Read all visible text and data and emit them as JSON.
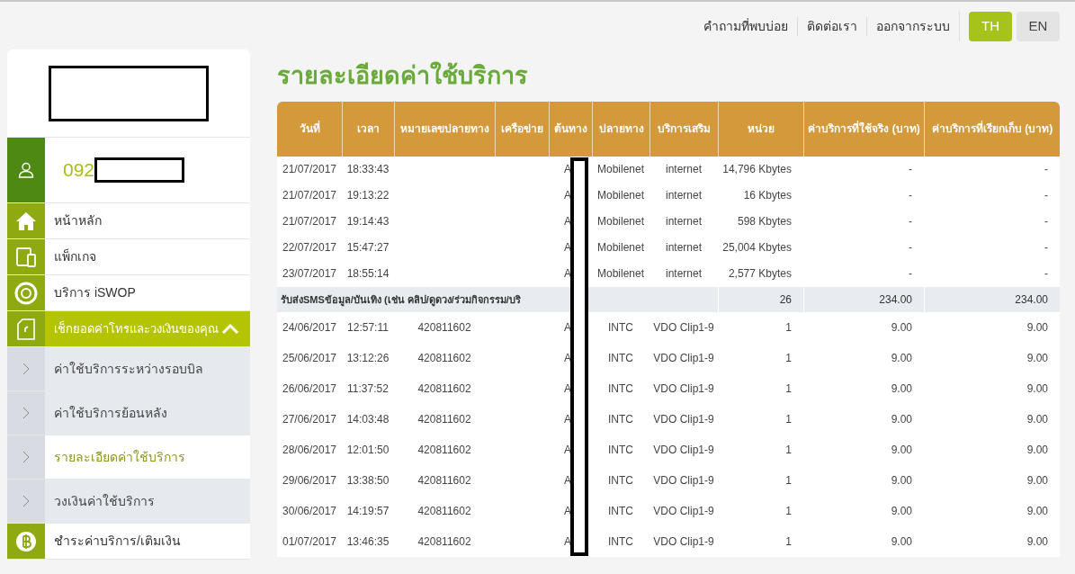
{
  "top_nav": {
    "links": [
      {
        "label": "คำถามที่พบบ่อย"
      },
      {
        "label": "ติดต่อเรา"
      },
      {
        "label": "ออกจากระบบ"
      }
    ],
    "languages": [
      {
        "label": "TH",
        "selected": true
      },
      {
        "label": "EN",
        "selected": false
      }
    ]
  },
  "sidebar": {
    "account_number": "092",
    "items": [
      {
        "label": "หน้าหลัก",
        "selected": false
      },
      {
        "label": "แพ็กเกจ",
        "selected": false
      },
      {
        "label": "บริการ iSWOP",
        "selected": false
      },
      {
        "label": "เช็กยอดค่าโทรและวงเงินของคุณ",
        "selected": true,
        "expanded": true,
        "children": [
          {
            "label": "ค่าใช้บริการระหว่างรอบบิล",
            "selected": false
          },
          {
            "label": "ค่าใช้บริการย้อนหลัง",
            "selected": false
          },
          {
            "label": "รายละเอียดค่าใช้บริการ",
            "selected": true
          },
          {
            "label": "วงเงินค่าใช้บริการ",
            "selected": false
          }
        ]
      },
      {
        "label": "ชำระค่าบริการ/เติมเงิน",
        "selected": false
      }
    ]
  },
  "page_title": "รายละเอียดค่าใช้บริการ",
  "table": {
    "columns": [
      "วันที่",
      "เวลา",
      "หมายเลขปลายทาง",
      "เครือข่าย",
      "ต้นทาง",
      "ปลายทาง",
      "บริการเสริม",
      "หน่วย",
      "ค่าบริการที่ใช้จริง (บาท)",
      "ค่าบริการที่เรียกเก็บ (บาท)"
    ],
    "rows": [
      {
        "kind": "row",
        "cells": [
          "21/07/2017",
          "18:33:43",
          "",
          "",
          "A",
          "Mobilenet",
          "internet",
          "14,796 Kbytes",
          "-",
          "-"
        ]
      },
      {
        "kind": "row",
        "cells": [
          "21/07/2017",
          "19:13:22",
          "",
          "",
          "A",
          "Mobilenet",
          "internet",
          "16 Kbytes",
          "-",
          "-"
        ]
      },
      {
        "kind": "row",
        "cells": [
          "21/07/2017",
          "19:14:43",
          "",
          "",
          "A",
          "Mobilenet",
          "internet",
          "598 Kbytes",
          "-",
          "-"
        ]
      },
      {
        "kind": "row",
        "cells": [
          "22/07/2017",
          "15:47:27",
          "",
          "",
          "A",
          "Mobilenet",
          "internet",
          "25,004 Kbytes",
          "-",
          "-"
        ]
      },
      {
        "kind": "row",
        "cells": [
          "23/07/2017",
          "18:55:14",
          "",
          "",
          "A",
          "Mobilenet",
          "internet",
          "2,577 Kbytes",
          "-",
          "-"
        ]
      },
      {
        "kind": "group",
        "cells": [
          "รับส่งSMSข้อมูล/บันเทิง (เช่น คลิป/ดูดวง/ร่วมกิจกรรม/บริ",
          "",
          "",
          "",
          "",
          "",
          "",
          "26",
          "234.00",
          "234.00"
        ]
      },
      {
        "kind": "row",
        "cells": [
          "24/06/2017",
          "12:57:11",
          "420811602",
          "",
          "A",
          "INTC",
          "VDO Clip1-9",
          "1",
          "9.00",
          "9.00"
        ]
      },
      {
        "kind": "row",
        "cells": [
          "25/06/2017",
          "13:12:26",
          "420811602",
          "",
          "A",
          "INTC",
          "VDO Clip1-9",
          "1",
          "9.00",
          "9.00"
        ]
      },
      {
        "kind": "row",
        "cells": [
          "26/06/2017",
          "11:37:52",
          "420811602",
          "",
          "A",
          "INTC",
          "VDO Clip1-9",
          "1",
          "9.00",
          "9.00"
        ]
      },
      {
        "kind": "row",
        "cells": [
          "27/06/2017",
          "14:03:48",
          "420811602",
          "",
          "A",
          "INTC",
          "VDO Clip1-9",
          "1",
          "9.00",
          "9.00"
        ]
      },
      {
        "kind": "row",
        "cells": [
          "28/06/2017",
          "12:01:50",
          "420811602",
          "",
          "A",
          "INTC",
          "VDO Clip1-9",
          "1",
          "9.00",
          "9.00"
        ]
      },
      {
        "kind": "row",
        "cells": [
          "29/06/2017",
          "13:38:50",
          "420811602",
          "",
          "A",
          "INTC",
          "VDO Clip1-9",
          "1",
          "9.00",
          "9.00"
        ]
      },
      {
        "kind": "row",
        "cells": [
          "30/06/2017",
          "14:19:57",
          "420811602",
          "",
          "A",
          "INTC",
          "VDO Clip1-9",
          "1",
          "9.00",
          "9.00"
        ]
      },
      {
        "kind": "row",
        "cells": [
          "01/07/2017",
          "13:46:35",
          "420811602",
          "",
          "A",
          "INTC",
          "VDO Clip1-9",
          "1",
          "9.00",
          "9.00"
        ]
      }
    ]
  }
}
